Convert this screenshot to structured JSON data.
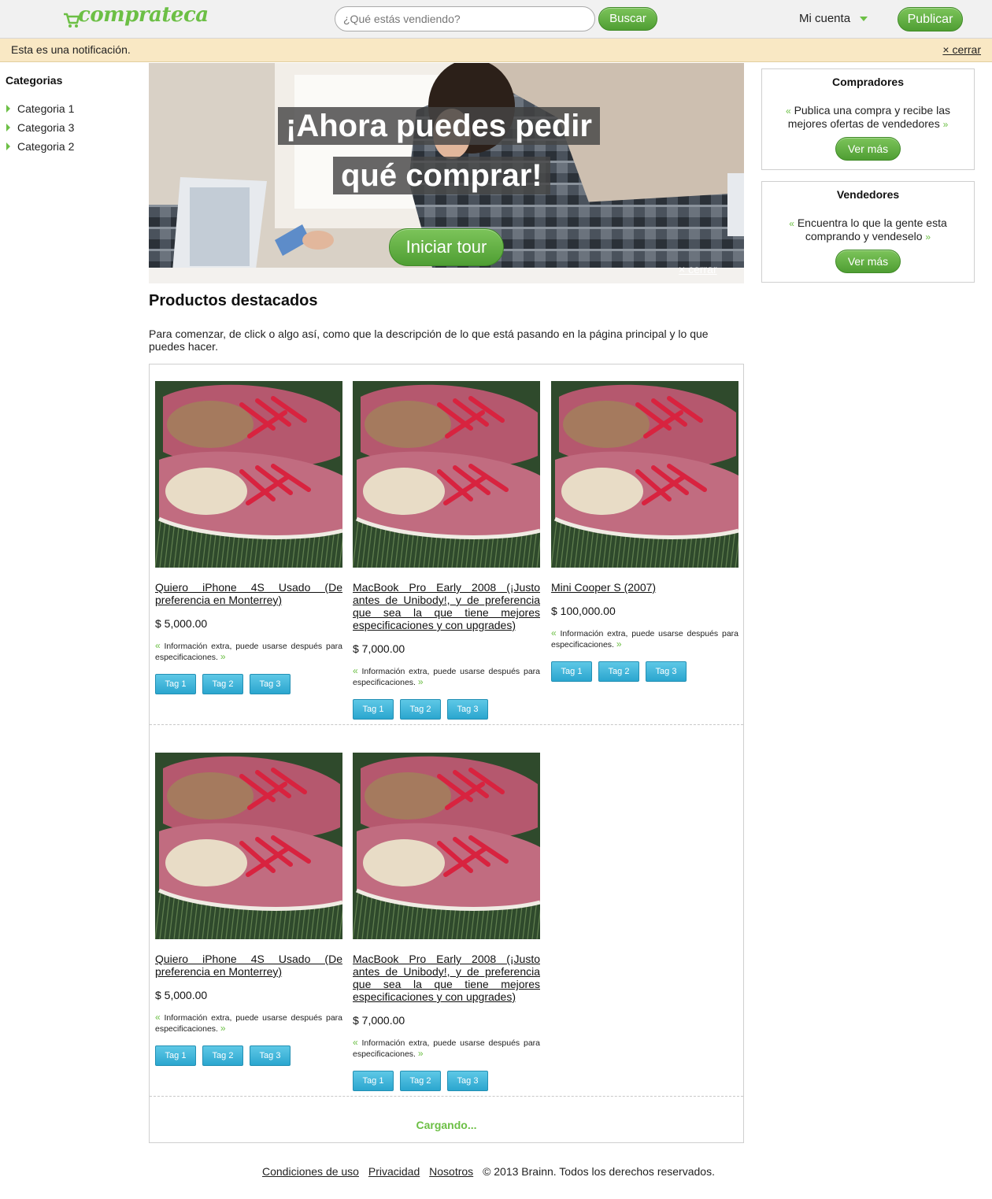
{
  "header": {
    "logo": "comprateca",
    "search_placeholder": "¿Qué estás vendiendo?",
    "search_button": "Buscar",
    "account": "Mi cuenta",
    "publish_button": "Publicar"
  },
  "notification": {
    "text": "Esta es una notificación.",
    "close": "× cerrar"
  },
  "sidebar": {
    "title": "Categorias",
    "items": [
      {
        "label": "Categoria 1"
      },
      {
        "label": "Categoria 3"
      },
      {
        "label": "Categoria 2"
      }
    ]
  },
  "hero": {
    "line1": "¡Ahora puedes pedir",
    "line2": "qué comprar!",
    "tour_button": "Iniciar tour",
    "close": "× cerrar"
  },
  "buyers_box": {
    "title": "Compradores",
    "open_quote": "«",
    "text": "Publica una compra y recibe las mejores ofertas de vendedores",
    "close_quote": "»",
    "button": "Ver más"
  },
  "sellers_box": {
    "title": "Vendedores",
    "open_quote": "«",
    "text": "Encuentra lo que la gente esta comprando y vendeselo",
    "close_quote": "»",
    "button": "Ver más"
  },
  "featured": {
    "title": "Productos destacados",
    "description": "Para comenzar, de click o algo así, como que la descripción de lo que está pasando en la página principal y lo que puedes hacer.",
    "loading": "Cargando...",
    "products": [
      {
        "title": "Quiero iPhone 4S Usado (De preferencia en Monterrey)",
        "price": "$ 5,000.00",
        "info": "Información extra, puede usarse después para especificaciones.",
        "tags": [
          "Tag 1",
          "Tag 2",
          "Tag 3"
        ]
      },
      {
        "title": "MacBook Pro Early 2008 (¡Justo antes de Unibody!, y de preferencia que sea la que tiene mejores especificaciones y con upgrades)",
        "price": "$ 7,000.00",
        "info": "Información extra, puede usarse después para especificaciones.",
        "tags": [
          "Tag 1",
          "Tag 2",
          "Tag 3"
        ]
      },
      {
        "title": "Mini Cooper S (2007)",
        "price": "$ 100,000.00",
        "info": "Información extra, puede usarse después para especificaciones.",
        "tags": [
          "Tag 1",
          "Tag 2",
          "Tag 3"
        ]
      },
      {
        "title": "Quiero iPhone 4S Usado (De preferencia en Monterrey)",
        "price": "$ 5,000.00",
        "info": "Información extra, puede usarse después para especificaciones.",
        "tags": [
          "Tag 1",
          "Tag 2",
          "Tag 3"
        ]
      },
      {
        "title": "MacBook Pro Early 2008 (¡Justo antes de Unibody!, y de preferencia que sea la que tiene mejores especificaciones y con upgrades)",
        "price": "$ 7,000.00",
        "info": "Información extra, puede usarse después para especificaciones.",
        "tags": [
          "Tag 1",
          "Tag 2",
          "Tag 3"
        ]
      }
    ]
  },
  "footer": {
    "links": [
      "Condiciones de uso",
      "Privacidad",
      "Nosotros"
    ],
    "copyright": "© 2013 Brainn. Todos los derechos reservados."
  },
  "colors": {
    "brand_green": "#6cbf45",
    "notification_bg": "#f9e8c4",
    "tag_blue": "#2ba6cf"
  }
}
